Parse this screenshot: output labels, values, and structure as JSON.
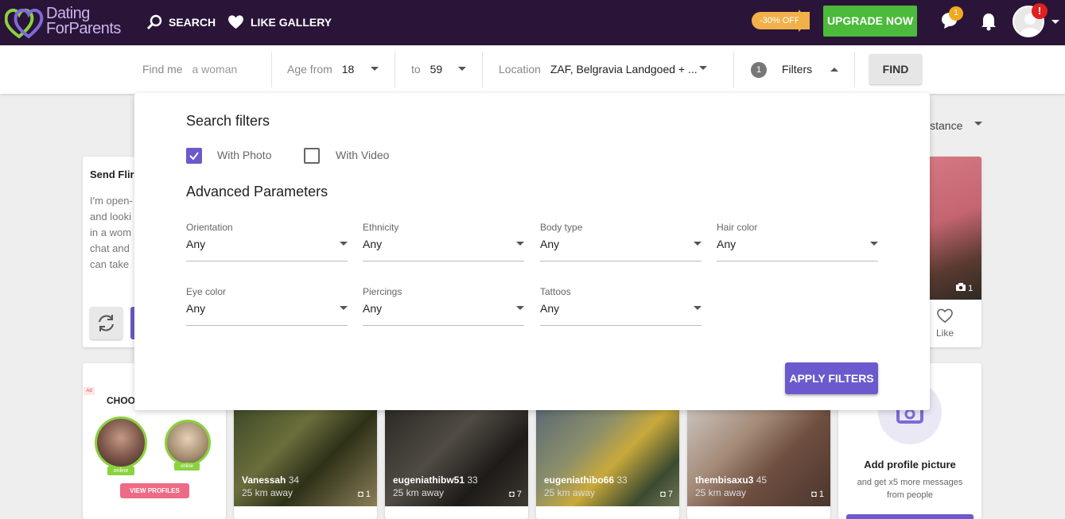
{
  "header": {
    "logo_line1": "Dating",
    "logo_line2": "ForParents",
    "nav_search": "SEARCH",
    "nav_like_gallery": "LIKE GALLERY",
    "promo": "-30% OFF",
    "upgrade": "UPGRADE NOW",
    "messages_count": "1",
    "alert_badge": "!"
  },
  "search": {
    "find_me_label": "Find me",
    "find_me_value": "a woman",
    "age_from_label": "Age from",
    "age_from_value": "18",
    "age_to_label": "to",
    "age_to_value": "59",
    "location_label": "Location",
    "location_value": "ZAF, Belgravia Landgoed + ...",
    "filters_count": "1",
    "filters_label": "Filters",
    "find_button": "FIND"
  },
  "sort": {
    "label": "istance"
  },
  "flirt": {
    "title": "Send Flir",
    "lines": [
      "I'm open-",
      "and looki",
      "in a wom",
      "chat and",
      "can take"
    ]
  },
  "like_card": {
    "photo_count": "1",
    "like_label": "Like"
  },
  "ad": {
    "tag": "Ad",
    "title": "CHOO",
    "online1": "online",
    "online2": "online",
    "button": "VIEW PROFILES"
  },
  "profiles": [
    {
      "name": "Vanessah",
      "age": "34",
      "distance": "25 km away",
      "photos": "1"
    },
    {
      "name": "eugeniathibw51",
      "age": "33",
      "distance": "25 km away",
      "photos": "7"
    },
    {
      "name": "eugeniathibo66",
      "age": "33",
      "distance": "25 km away",
      "photos": "7"
    },
    {
      "name": "thembisaxu3",
      "age": "45",
      "distance": "25 km away",
      "photos": "1"
    }
  ],
  "add_picture": {
    "title": "Add profile picture",
    "subtitle_line1": "and get x5 more messages",
    "subtitle_line2": "from people"
  },
  "panel": {
    "title": "Search filters",
    "with_photo": "With Photo",
    "with_photo_checked": true,
    "with_video": "With Video",
    "with_video_checked": false,
    "advanced_title": "Advanced Parameters",
    "filters": [
      {
        "label": "Orientation",
        "value": "Any"
      },
      {
        "label": "Ethnicity",
        "value": "Any"
      },
      {
        "label": "Body type",
        "value": "Any"
      },
      {
        "label": "Hair color",
        "value": "Any"
      },
      {
        "label": "Eye color",
        "value": "Any"
      },
      {
        "label": "Piercings",
        "value": "Any"
      },
      {
        "label": "Tattoos",
        "value": "Any"
      }
    ],
    "apply_button": "APPLY FILTERS"
  },
  "colors": {
    "topbar": "#2a1538",
    "accent": "#6a5acd",
    "upgrade": "#4cba3b",
    "promo": "#f2b04a"
  }
}
